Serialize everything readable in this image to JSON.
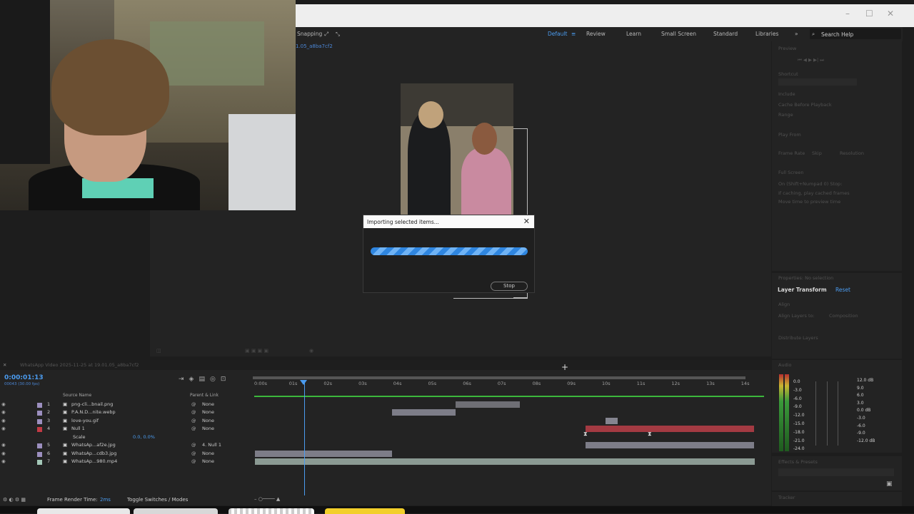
{
  "workspace": {
    "snapping_label": "Snapping",
    "items": [
      "Default",
      "Review",
      "Learn",
      "Small Screen",
      "Standard",
      "Libraries"
    ],
    "active": "Default",
    "search_placeholder": "Search Help"
  },
  "composition": {
    "tab_label": "1.05_a8ba7cf2",
    "timeline_tab_label": "WhatsApp Video 2025-11-25 at 19.01.05_a8ba7cf2"
  },
  "dialog": {
    "title": "Importing selected items...",
    "progress": 1.0,
    "stop_label": "Stop"
  },
  "preview_panel": {
    "title": "Preview",
    "labels": [
      "Shortcut",
      "Include",
      "Cache Before Playback",
      "Range",
      "Play From",
      "Frame Rate",
      "Skip",
      "Resolution",
      "Full Screen",
      "On (Shift+Numpad 0) Stop:",
      "If caching, play cached frames",
      "Move time to preview time"
    ]
  },
  "properties_panel": {
    "title": "Properties: No selection",
    "section": "Layer Transform",
    "reset_label": "Reset",
    "align_label": "Align",
    "align_layers_to": "Align Layers to:",
    "align_to_value": "Composition",
    "distribute_label": "Distribute Layers"
  },
  "audio_panel": {
    "title": "Audio",
    "left_scale": [
      "0.0",
      "-3.0",
      "-6.0",
      "-9.0",
      "-12.0",
      "-15.0",
      "-18.0",
      "-21.0",
      "-24.0"
    ],
    "right_scale": [
      "12.0 dB",
      "9.0",
      "6.0",
      "3.0",
      "0.0 dB",
      "-3.0",
      "-6.0",
      "-9.0",
      "-12.0 dB"
    ]
  },
  "effects_panel": {
    "title": "Effects & Presets"
  },
  "tracker_panel": {
    "title": "Tracker"
  },
  "timeline": {
    "timecode": "0:00:01:13",
    "frames_sub": "00043 (30.00 fps)",
    "ruler_ticks": [
      "0:00s",
      "01s",
      "02s",
      "03s",
      "04s",
      "05s",
      "06s",
      "07s",
      "08s",
      "09s",
      "10s",
      "11s",
      "12s",
      "13s",
      "14s"
    ],
    "col_source": "Source Name",
    "col_parent": "Parent & Link",
    "layers": [
      {
        "num": "1",
        "name": "png-cli...bnail.png",
        "parent": "None",
        "swatch": "#9c8fbf"
      },
      {
        "num": "2",
        "name": "P.A.N.D...nite.webp",
        "parent": "None",
        "swatch": "#9c8fbf"
      },
      {
        "num": "3",
        "name": "love-you.gif",
        "parent": "None",
        "swatch": "#9c8fbf"
      },
      {
        "num": "4",
        "name": "Null 1",
        "parent": "None",
        "swatch": "#c23a44"
      },
      {
        "num": "",
        "name": "Scale",
        "parent": "",
        "value": "0.0, 0.0%",
        "swatch": ""
      },
      {
        "num": "5",
        "name": "WhatsAp...af2e.jpg",
        "parent": "4. Null 1",
        "swatch": "#9c8fbf"
      },
      {
        "num": "6",
        "name": "WhatsAp...cdb3.jpg",
        "parent": "None",
        "swatch": "#9c8fbf"
      },
      {
        "num": "7",
        "name": "WhatsAp...980.mp4",
        "parent": "None",
        "swatch": "#a4c8b8"
      }
    ]
  },
  "statusbar": {
    "render_label": "Frame Render Time:",
    "render_value": "2ms",
    "toggle_label": "Toggle Switches / Modes"
  }
}
